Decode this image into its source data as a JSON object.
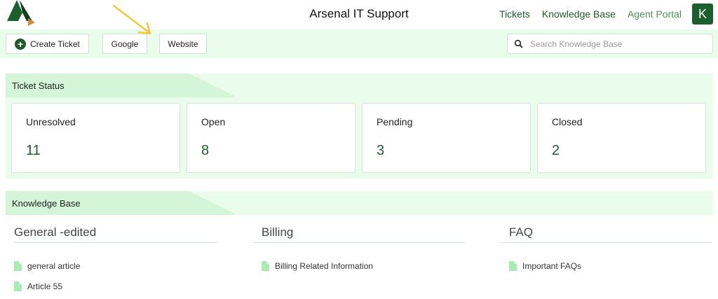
{
  "header": {
    "title": "Arsenal IT Support",
    "nav": [
      "Tickets",
      "Knowledge Base",
      "Agent Portal"
    ],
    "avatar_letter": "K"
  },
  "toolbar": {
    "create_label": "Create Ticket",
    "google_label": "Google",
    "website_label": "Website",
    "search_placeholder": "Search Knowledge Base"
  },
  "ticket_status": {
    "heading": "Ticket Status",
    "cards": [
      {
        "label": "Unresolved",
        "count": "11"
      },
      {
        "label": "Open",
        "count": "8"
      },
      {
        "label": "Pending",
        "count": "3"
      },
      {
        "label": "Closed",
        "count": "2"
      }
    ]
  },
  "knowledge_base": {
    "heading": "Knowledge Base",
    "categories": [
      {
        "title": "General -edited",
        "articles": [
          "general article",
          "Article 55"
        ]
      },
      {
        "title": "Billing",
        "articles": [
          "Billing Related Information"
        ]
      },
      {
        "title": "FAQ",
        "articles": [
          "Important FAQs"
        ]
      }
    ]
  },
  "colors": {
    "brand": "#1f5a2c",
    "panel_bg": "#eafcec",
    "panel_tab": "#d4f5d8",
    "annotation_arrow": "#f2c93a"
  },
  "icons": [
    "logo",
    "plus-circle-icon",
    "search-icon",
    "document-icon",
    "arrow-annotation"
  ]
}
